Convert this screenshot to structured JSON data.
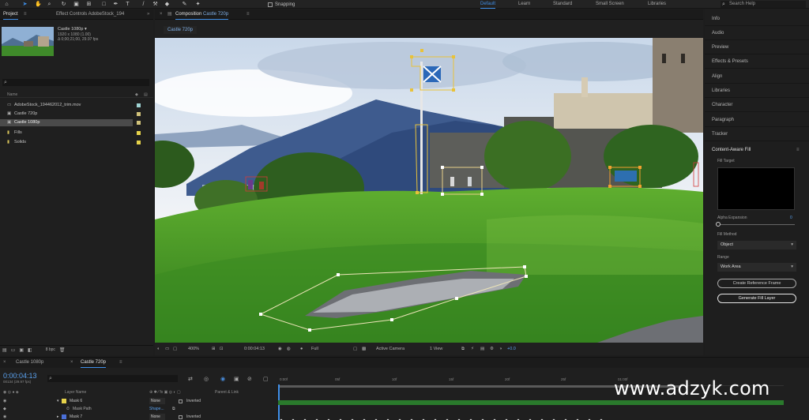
{
  "toolbar": {
    "snapping_label": "Snapping",
    "workspaces": [
      "Default",
      "Learn",
      "Standard",
      "Small Screen",
      "Libraries"
    ],
    "active_workspace": "Default",
    "search_help_placeholder": "Search Help"
  },
  "project_panel": {
    "tabs": [
      "Project",
      "Effect Controls AdobeStock_194"
    ],
    "thumbnail": {
      "name": "Castle 1080p ▾",
      "size": "1920 x 1080 (1.00)",
      "duration": "Δ 0;00;21;00, 29.97 fps"
    },
    "column_header": "Name",
    "items": [
      {
        "name": "AdobeStock_194462012_trim.mov",
        "icon": "film-icon",
        "label_color": "#9fd3d3"
      },
      {
        "name": "Castle 720p",
        "icon": "comp-icon",
        "label_color": "#d1c27a"
      },
      {
        "name": "Castle 1080p",
        "icon": "comp-icon",
        "label_color": "#d1c27a",
        "selected": true
      },
      {
        "name": "Fills",
        "icon": "folder-icon",
        "label_color": "#e6d24a"
      },
      {
        "name": "Solids",
        "icon": "folder-icon",
        "label_color": "#e6d24a"
      }
    ],
    "bpc": "8 bpc"
  },
  "composition": {
    "tab": "Composition",
    "comp_name": "Castle 720p",
    "subtab": "Castle 720p",
    "zoom": "400%",
    "timecode": "0:00:04:13",
    "resolution": "Full",
    "camera": "Active Camera",
    "views": "1 View",
    "exposure": "+0.0"
  },
  "right_panel": {
    "items": [
      "Info",
      "Audio",
      "Preview",
      "Effects & Presets",
      "Align",
      "Libraries",
      "Character",
      "Paragraph",
      "Tracker"
    ],
    "content_aware_fill": {
      "title": "Content-Aware Fill",
      "fill_target_label": "Fill Target",
      "alpha_expansion_label": "Alpha Expansion",
      "alpha_expansion_value": "0",
      "fill_method_label": "Fill Method",
      "fill_method": "Object",
      "range_label": "Range",
      "range": "Work Area",
      "create_reference_frame": "Create Reference Frame",
      "generate_fill_layer": "Generate Fill Layer"
    }
  },
  "timeline": {
    "tabs": [
      "Castle 1080p",
      "Castle 720p"
    ],
    "active_tab": "Castle 720p",
    "timecode": "0:00:04:13",
    "frames": "00134 (29.97 fps)",
    "headers": {
      "layer_name": "Layer Name",
      "parent": "Parent & Link"
    },
    "rows": [
      {
        "name": "Mask 6",
        "mode": "None",
        "inverted": "Inverted"
      },
      {
        "name": "Mask Path",
        "mode": "Shape...",
        "inverted": ""
      },
      {
        "name": "Mask 7",
        "mode": "None",
        "inverted": "Inverted"
      }
    ],
    "ruler_ticks": [
      "0:00f",
      "05f",
      "10f",
      "15f",
      "20f",
      "25f",
      "01:00f"
    ]
  },
  "watermark": "www.adzyk.com"
}
